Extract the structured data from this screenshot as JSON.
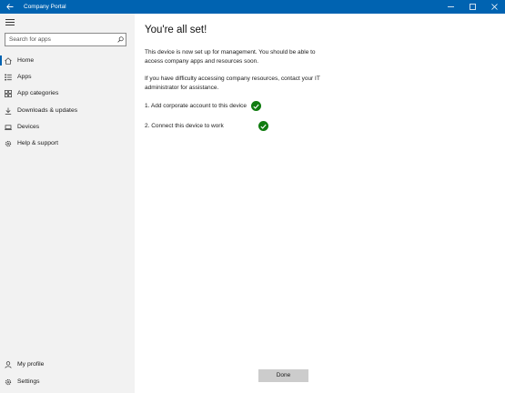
{
  "window": {
    "title": "Company Portal",
    "controls": [
      "minimize-icon",
      "maximize-icon",
      "close-icon"
    ]
  },
  "sidebar": {
    "search_placeholder": "Search for apps",
    "items": [
      {
        "label": "Home",
        "icon": "home-icon",
        "active": true
      },
      {
        "label": "Apps",
        "icon": "apps-list-icon"
      },
      {
        "label": "App categories",
        "icon": "categories-icon"
      },
      {
        "label": "Downloads & updates",
        "icon": "download-icon"
      },
      {
        "label": "Devices",
        "icon": "laptop-icon"
      },
      {
        "label": "Help & support",
        "icon": "gear-icon"
      }
    ],
    "bottom_items": [
      {
        "label": "My profile",
        "icon": "person-icon"
      },
      {
        "label": "Settings",
        "icon": "gear-icon"
      }
    ]
  },
  "main": {
    "heading": "You're all set!",
    "para1": "This device is now set up for management.  You should be able to access company apps and resources soon.",
    "para2": "If you have difficulty accessing company resources, contact your IT administrator for assistance.",
    "steps": [
      {
        "label": "1. Add corporate account to this device",
        "status": "complete"
      },
      {
        "label": "2. Connect this device to work",
        "status": "complete"
      }
    ],
    "done_label": "Done"
  },
  "colors": {
    "titlebar": "#0063b1",
    "sidebar_bg": "#f2f2f2",
    "check_green": "#107c10",
    "button_gray": "#cccccc"
  }
}
